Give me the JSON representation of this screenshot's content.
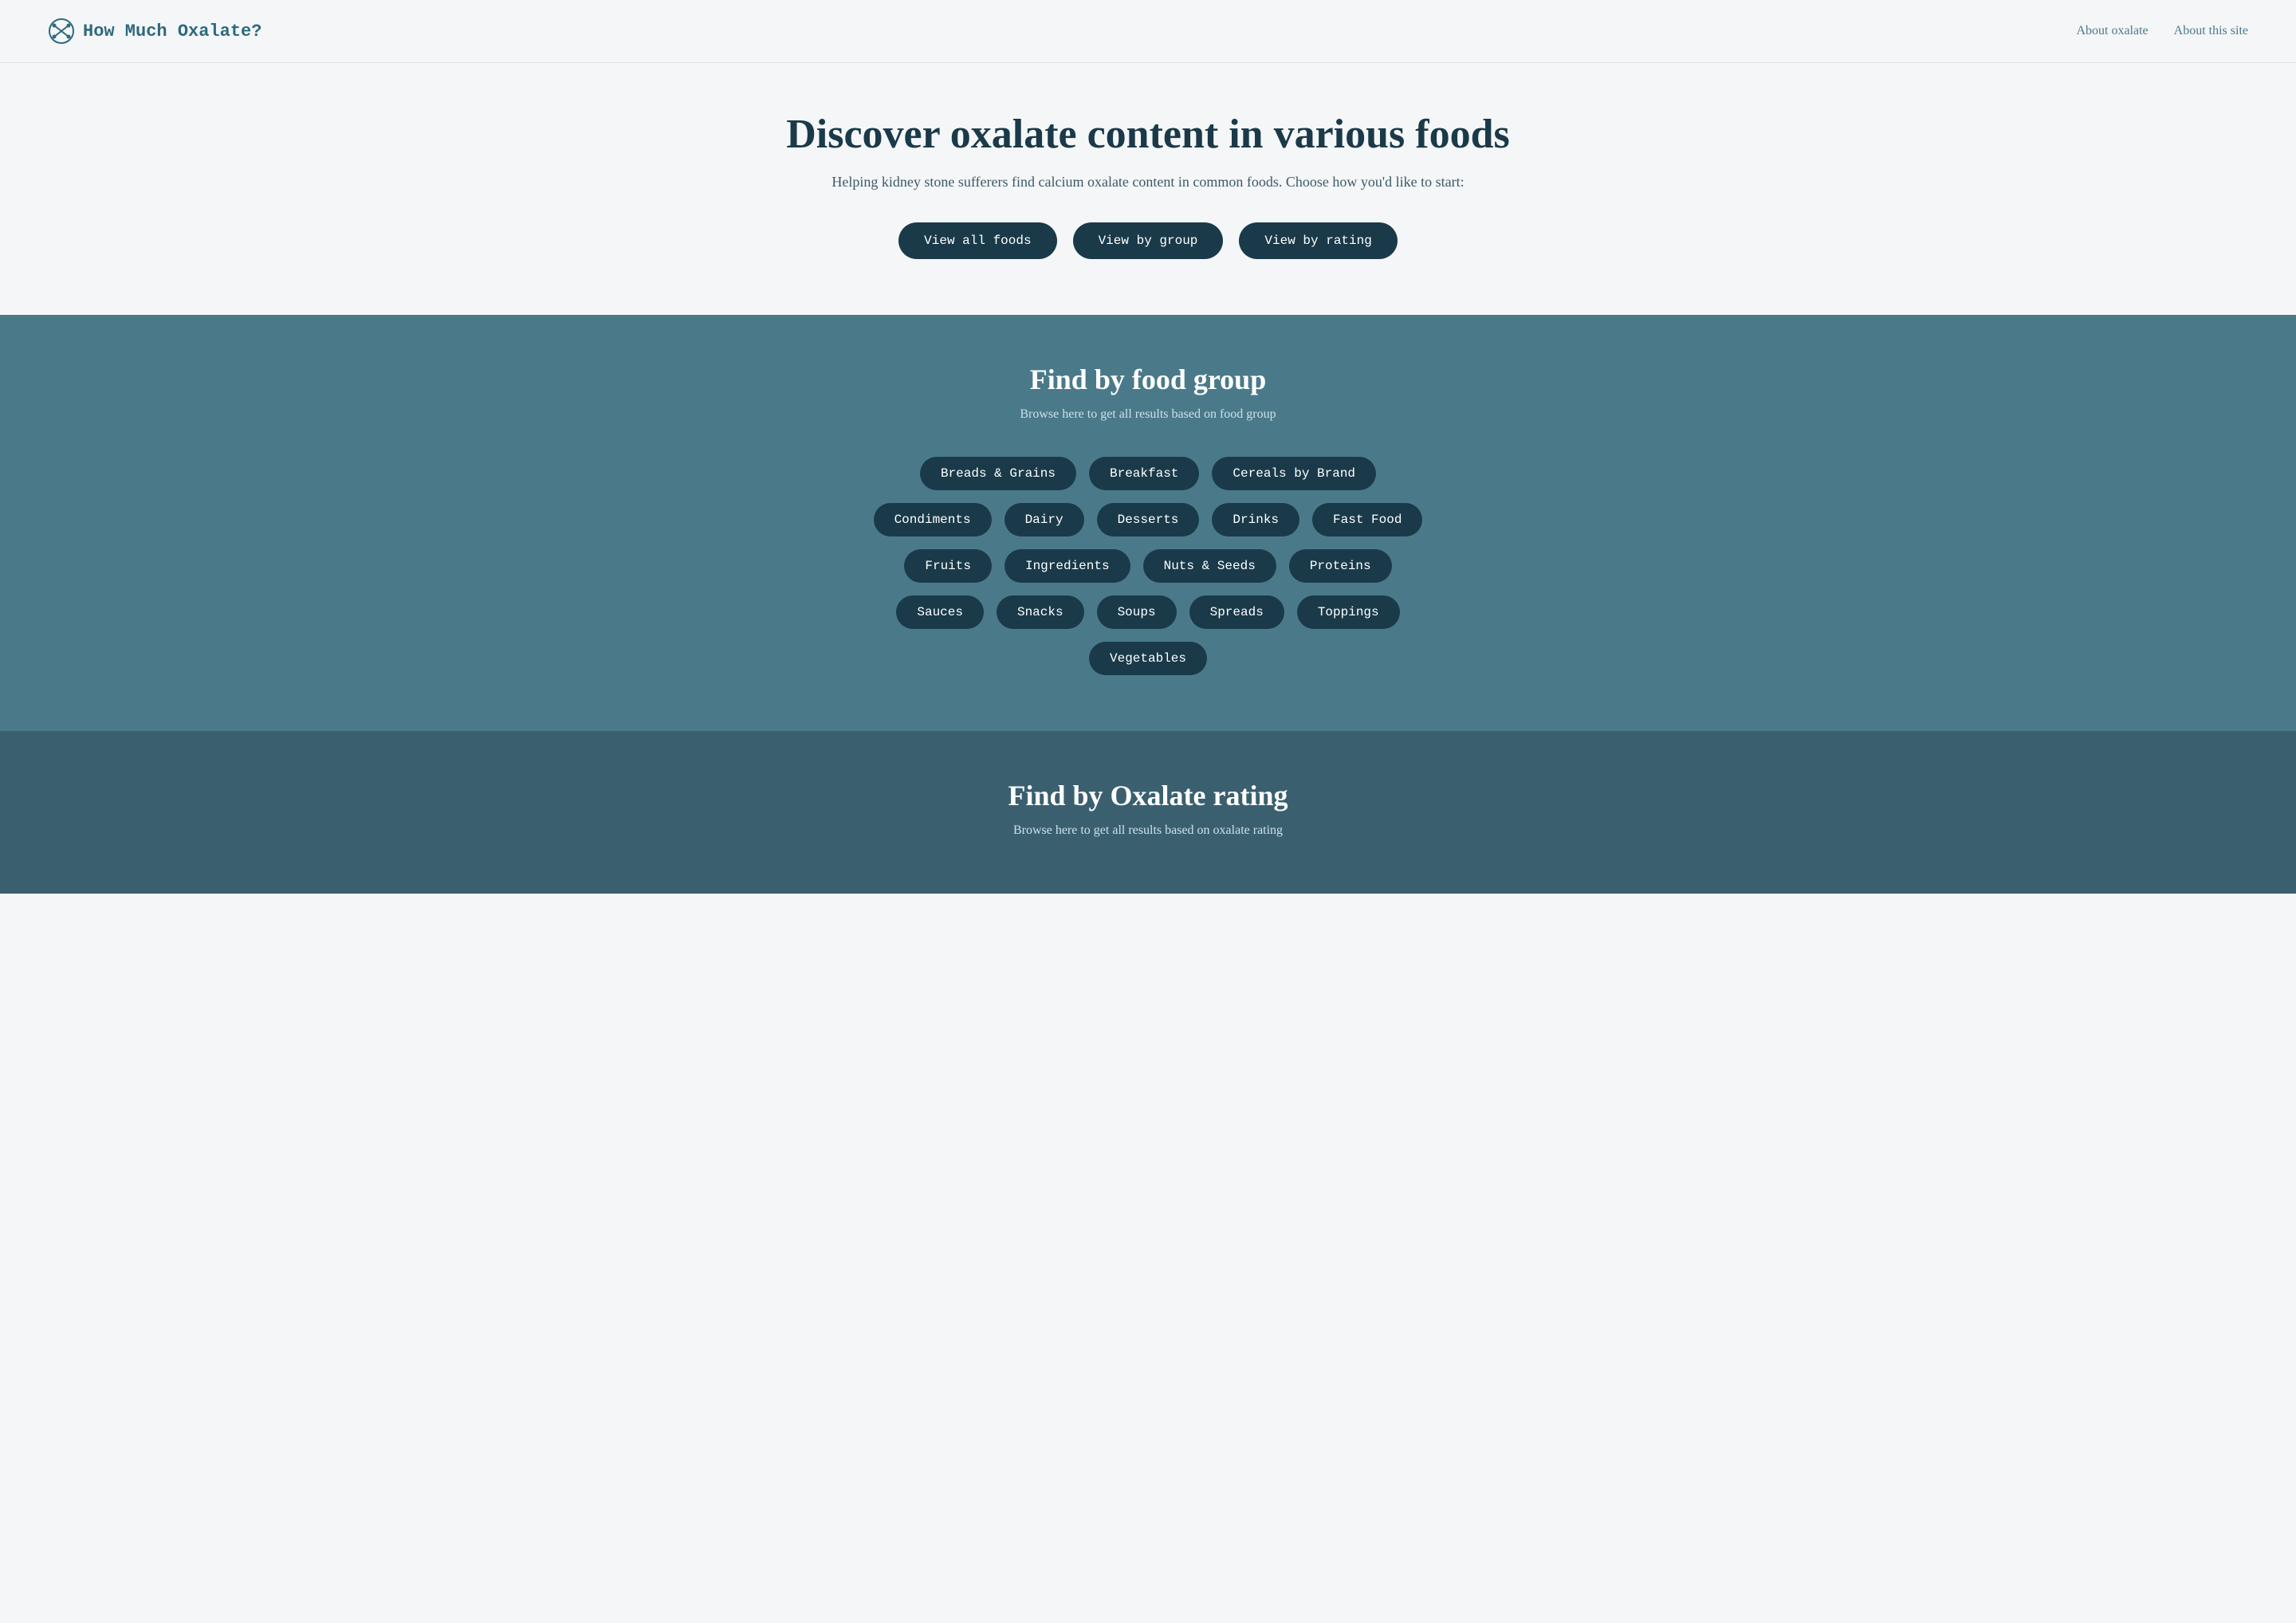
{
  "nav": {
    "logo_text": "How Much Oxalate?",
    "links": [
      {
        "label": "About oxalate",
        "href": "#"
      },
      {
        "label": "About this site",
        "href": "#"
      }
    ]
  },
  "hero": {
    "title": "Discover oxalate content in various foods",
    "subtitle": "Helping kidney stone sufferers find calcium oxalate content in common foods. Choose how you'd like to start:",
    "buttons": [
      {
        "label": "View all foods",
        "id": "view-all"
      },
      {
        "label": "View by group",
        "id": "view-group"
      },
      {
        "label": "View by rating",
        "id": "view-rating"
      }
    ]
  },
  "food_group_section": {
    "heading": "Find by food group",
    "subtitle": "Browse here to get all results based on food group",
    "tags": [
      "Breads & Grains",
      "Breakfast",
      "Cereals by Brand",
      "Condiments",
      "Dairy",
      "Desserts",
      "Drinks",
      "Fast Food",
      "Fruits",
      "Ingredients",
      "Nuts & Seeds",
      "Proteins",
      "Sauces",
      "Snacks",
      "Soups",
      "Spreads",
      "Toppings",
      "Vegetables"
    ]
  },
  "rating_section": {
    "heading": "Find by Oxalate rating",
    "subtitle": "Browse here to get all results based on oxalate rating"
  }
}
